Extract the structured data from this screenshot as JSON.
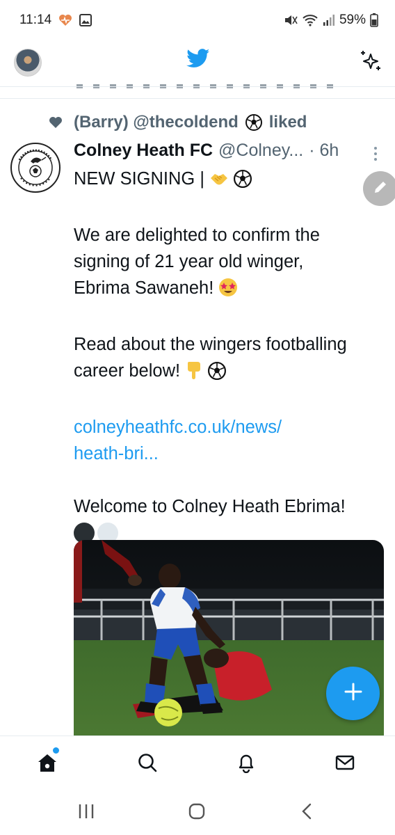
{
  "status_bar": {
    "time": "11:14",
    "battery": "59%"
  },
  "top_bar": {
    "logo": "twitter-bird-icon",
    "sparkle": "sparkle-icon"
  },
  "tweet": {
    "social_context": "(Barry) @thecoldend",
    "liked_label": "liked",
    "author_name": "Colney Heath FC",
    "author_handle": "@Colney...",
    "time": "· 6h",
    "line1": "NEW SIGNING |",
    "line2": "We are delighted to confirm the",
    "line3": "signing of 21 year old winger,",
    "line4": "Ebrima Sawaneh!",
    "line5": "Read about the wingers footballing",
    "line6": "career below!",
    "link1": "colneyheathfc.co.uk/news/",
    "link2": "heath-bri...",
    "line7": "Welcome to Colney Heath Ebrima!"
  },
  "bottom_nav": {
    "items": [
      "home-icon",
      "search-icon",
      "notifications-icon",
      "messages-icon"
    ]
  },
  "colors": {
    "accent": "#1d9bf0",
    "secondary_text": "#536471"
  }
}
